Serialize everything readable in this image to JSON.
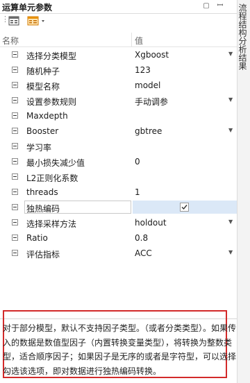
{
  "panel": {
    "title": "运算单元参数",
    "pin_icon": "pin-icon",
    "close_icon": "close-icon"
  },
  "toolbar": {
    "buttons": [
      "property-grid-icon",
      "sort-icon"
    ]
  },
  "header": {
    "name_col": "名称",
    "value_col": "值"
  },
  "rows": [
    {
      "label": "选择分类模型",
      "value": "Xgboost",
      "dropdown": true
    },
    {
      "label": "随机种子",
      "value": "123",
      "dropdown": false
    },
    {
      "label": "模型名称",
      "value": "model",
      "dropdown": false
    },
    {
      "label": "设置参数规则",
      "value": "手动调参",
      "dropdown": true
    },
    {
      "label": "Maxdepth",
      "value": "",
      "dropdown": false
    },
    {
      "label": "Booster",
      "value": "gbtree",
      "dropdown": true
    },
    {
      "label": "学习率",
      "value": "",
      "dropdown": false
    },
    {
      "label": "最小损失减少值",
      "value": "0",
      "dropdown": false
    },
    {
      "label": "L2正则化系数",
      "value": "",
      "dropdown": false
    },
    {
      "label": "threads",
      "value": "1",
      "dropdown": false
    },
    {
      "label": "独热编码",
      "value": "",
      "dropdown": false,
      "checkbox": true,
      "checked": true
    },
    {
      "label": "选择采样方法",
      "value": "holdout",
      "dropdown": true
    },
    {
      "label": "Ratio",
      "value": "0.8",
      "dropdown": false
    },
    {
      "label": "评估指标",
      "value": "ACC",
      "dropdown": true
    }
  ],
  "description": "对于部分模型，默认不支持因子类型。（或者分类类型）。如果传入的数据是数值型因子（内置转换变量类型），将转换为整数类型，适合顺序因子；如果因子是无序的或者是字符型，可以选择勾选该选项，即对数据进行独热编码转换。",
  "side_tab": "流程结构分析结果"
}
